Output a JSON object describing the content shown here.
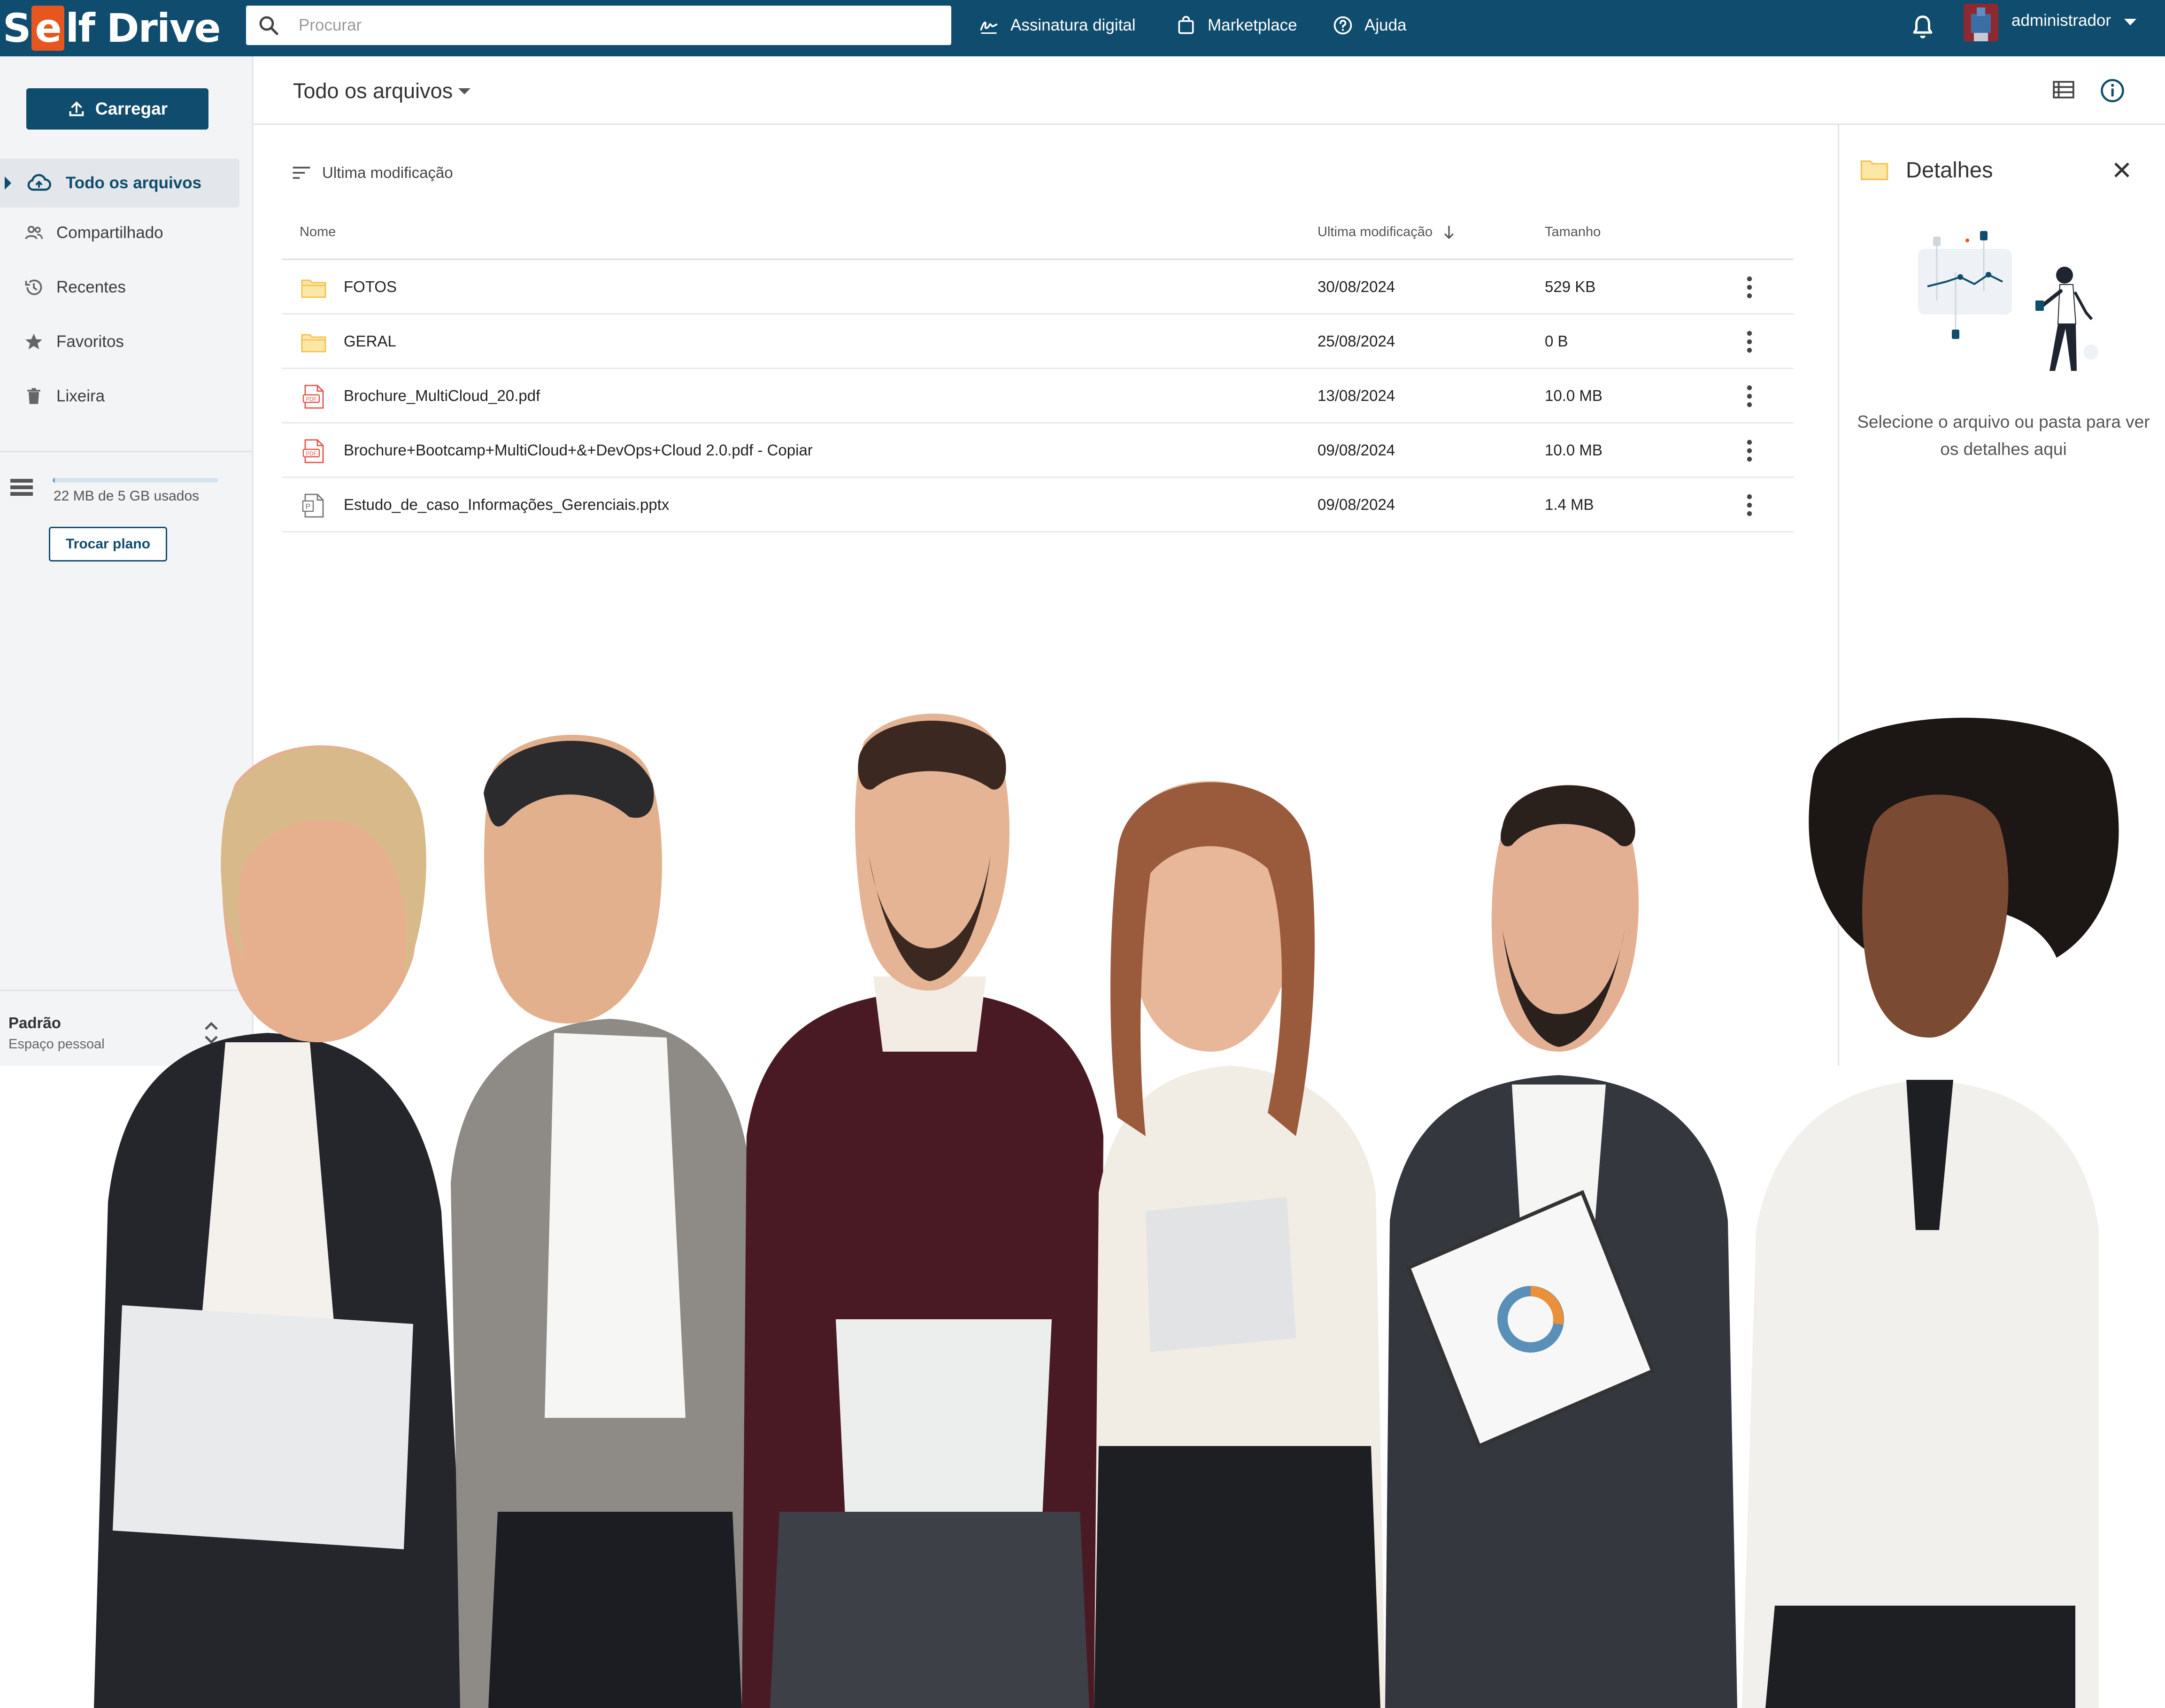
{
  "app": {
    "logo_text": "Self Drive",
    "brand_color": "#0f4c6e",
    "logo_accent_color": "#e8561f"
  },
  "header": {
    "search_placeholder": "Procurar",
    "nav": [
      {
        "label": "Assinatura digital",
        "icon": "signature-icon"
      },
      {
        "label": "Marketplace",
        "icon": "shopping-bag-icon"
      },
      {
        "label": "Ajuda",
        "icon": "help-circle-icon"
      }
    ],
    "user_name": "administrador"
  },
  "sidebar": {
    "upload_label": "Carregar",
    "items": [
      {
        "label": "Todo os arquivos",
        "icon": "cloud-upload-icon",
        "active": true
      },
      {
        "label": "Compartilhado",
        "icon": "people-icon"
      },
      {
        "label": "Recentes",
        "icon": "history-icon"
      },
      {
        "label": "Favoritos",
        "icon": "star-icon"
      },
      {
        "label": "Lixeira",
        "icon": "trash-icon"
      }
    ],
    "storage_text": "22 MB de 5 GB usados",
    "storage_used_fraction": 0.0044,
    "change_plan_label": "Trocar plano",
    "workspace_title": "Padrão",
    "workspace_subtitle": "Espaço pessoal"
  },
  "main": {
    "folder_title": "Todo os arquivos",
    "sort_label": "Ultima modificação",
    "columns": {
      "name": "Nome",
      "modified": "Ultima modificação",
      "size": "Tamanho"
    },
    "rows": [
      {
        "name": "FOTOS",
        "type": "folder",
        "modified": "30/08/2024",
        "size": "529 KB"
      },
      {
        "name": "GERAL",
        "type": "folder",
        "modified": "25/08/2024",
        "size": "0 B"
      },
      {
        "name": "Brochure_MultiCloud_20.pdf",
        "type": "pdf",
        "modified": "13/08/2024",
        "size": "10.0 MB"
      },
      {
        "name": "Brochure+Bootcamp+MultiCloud+&+DevOps+Cloud 2.0.pdf - Copiar",
        "type": "pdf",
        "modified": "09/08/2024",
        "size": "10.0 MB"
      },
      {
        "name": "Estudo_de_caso_Informações_Gerenciais.pptx",
        "type": "pptx",
        "modified": "09/08/2024",
        "size": "1.4 MB"
      }
    ]
  },
  "details": {
    "title": "Detalhes",
    "message": "Selecione o arquivo ou pasta para ver os detalhes aqui"
  }
}
